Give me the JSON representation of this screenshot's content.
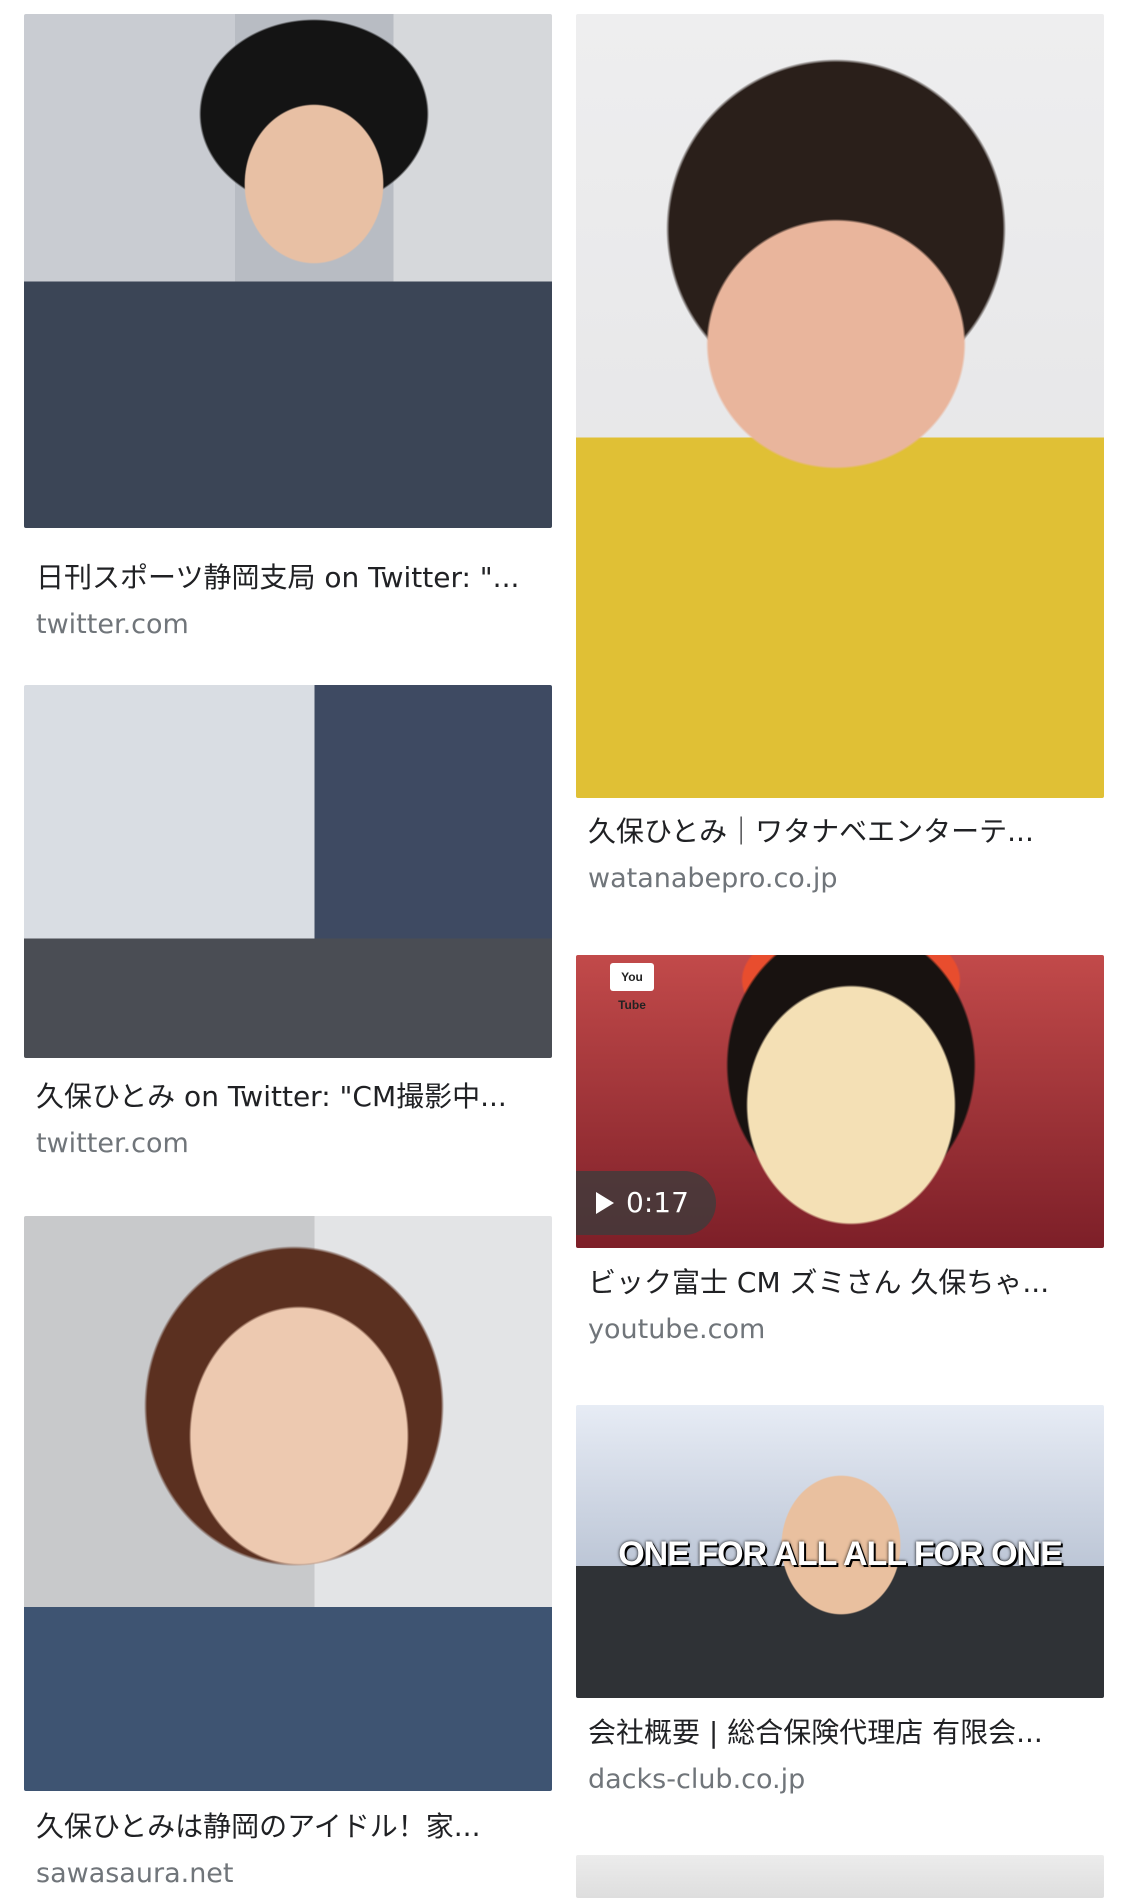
{
  "results": {
    "left": [
      {
        "title": "日刊スポーツ静岡支局 on Twitter: \"...",
        "domain": "twitter.com",
        "image": "man-in-sunglasses-and-suit"
      },
      {
        "title": "久保ひとみ on Twitter: \"CM撮影中...",
        "domain": "twitter.com",
        "image": "group-dance-outside-building"
      },
      {
        "title": "久保ひとみは静岡のアイドル！家...",
        "domain": "sawasaura.net",
        "image": "smiling-woman-denim-jacket"
      }
    ],
    "right": [
      {
        "title": "久保ひとみ｜ワタナベエンターテ...",
        "domain": "watanabepro.co.jp",
        "image": "woman-yellow-top-portrait"
      },
      {
        "title": "ビック富士 CM ズミさん 久保ちゃ...",
        "domain": "youtube.com",
        "image": "video-thumbnail-surprised-woman",
        "duration": "0:17",
        "badge": "You Tube"
      },
      {
        "title": "会社概要 | 総合保険代理店 有限会...",
        "domain": "dacks-club.co.jp",
        "image": "group-photo-banner",
        "overlay": "ONE FOR ALL  ALL FOR ONE"
      },
      {
        "title": "",
        "domain": "",
        "image": "partial-next-result"
      }
    ]
  }
}
